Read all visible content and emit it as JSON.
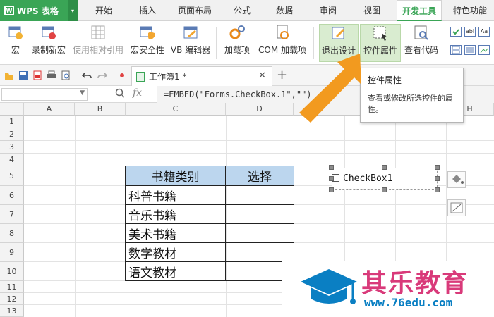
{
  "app": {
    "menu_label": "WPS 表格",
    "tabs": [
      "开始",
      "插入",
      "页面布局",
      "公式",
      "数据",
      "审阅",
      "视图",
      "开发工具",
      "特色功能"
    ],
    "active_tab": "开发工具"
  },
  "ribbon": {
    "buttons": [
      {
        "label": "宏"
      },
      {
        "label": "录制新宏"
      },
      {
        "label": "使用相对引用"
      },
      {
        "label": "宏安全性"
      },
      {
        "label": "VB 编辑器"
      },
      {
        "label": "加载项"
      },
      {
        "label": "COM 加载项"
      },
      {
        "label": "退出设计"
      },
      {
        "label": "控件属性"
      },
      {
        "label": "查看代码"
      }
    ],
    "mini_labels": [
      "abl",
      "Aa"
    ]
  },
  "document": {
    "tab_title": "工作簿1 *"
  },
  "formula_bar": {
    "name_box": "",
    "fx_label": "fx",
    "formula": "=EMBED(\"Forms.CheckBox.1\",\"\")"
  },
  "sheet": {
    "columns": [
      "A",
      "B",
      "C",
      "D",
      "E",
      "F",
      "G",
      "H"
    ],
    "rows": [
      "1",
      "2",
      "3",
      "4",
      "5",
      "6",
      "7",
      "8",
      "9",
      "10",
      "11",
      "12",
      "13"
    ],
    "table": {
      "headers": [
        "书籍类别",
        "选择"
      ],
      "items": [
        "科普书籍",
        "音乐书籍",
        "美术书籍",
        "数学教材",
        "语文教材"
      ]
    },
    "checkbox_caption": "CheckBox1"
  },
  "tooltip": {
    "title": "控件属性",
    "body": "查看或修改所选控件的属性。"
  },
  "watermark": {
    "name": "其乐教育",
    "url": "www.76edu.com"
  },
  "colors": {
    "accent": "#3aa556",
    "header_fill": "#bcd6ee",
    "arrow": "#f29a1f",
    "watermark_text": "#d93a7a",
    "watermark_url": "#0a7fc3"
  }
}
